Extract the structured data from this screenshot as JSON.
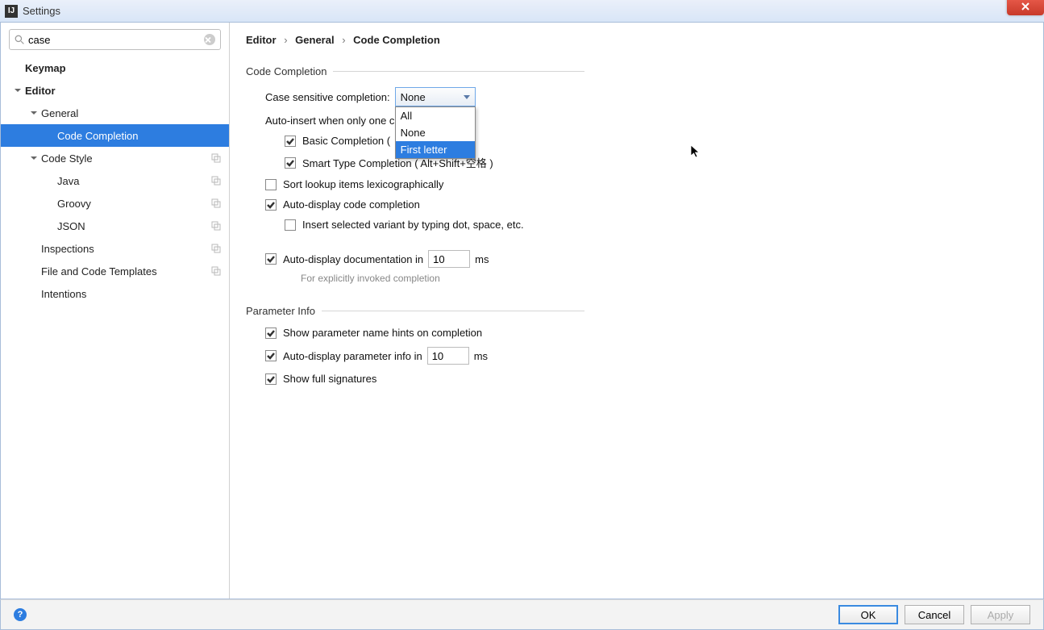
{
  "title": "Settings",
  "search": {
    "value": "case"
  },
  "tree": {
    "keymap": "Keymap",
    "editor": "Editor",
    "general": "General",
    "code_completion": "Code Completion",
    "code_style": "Code Style",
    "java": "Java",
    "groovy": "Groovy",
    "json": "JSON",
    "inspections": "Inspections",
    "file_templates": "File and Code Templates",
    "intentions": "Intentions"
  },
  "breadcrumb": {
    "p1": "Editor",
    "p2": "General",
    "p3": "Code Completion"
  },
  "sections": {
    "code_completion": {
      "legend": "Code Completion",
      "case_sensitive_label": "Case sensitive completion:",
      "combo_selected": "None",
      "combo_options": {
        "o1": "All",
        "o2": "None",
        "o3": "First letter"
      },
      "auto_insert_label": "Auto-insert when only one c",
      "basic_completion": "Basic Completion (",
      "smart_type_completion": "Smart Type Completion ( Alt+Shift+空格 )",
      "sort_lexico": "Sort lookup items lexicographically",
      "auto_display_cc": "Auto-display code completion",
      "insert_variant": "Insert selected variant by typing dot, space, etc.",
      "auto_doc_label_pre": "Auto-display documentation in",
      "auto_doc_value": "10",
      "auto_doc_label_post": "ms",
      "auto_doc_hint": "For explicitly invoked completion"
    },
    "parameter_info": {
      "legend": "Parameter Info",
      "show_param_hints": "Show parameter name hints on completion",
      "auto_param_pre": "Auto-display parameter info in",
      "auto_param_value": "10",
      "auto_param_post": "ms",
      "show_full_sig": "Show full signatures"
    }
  },
  "buttons": {
    "ok": "OK",
    "cancel": "Cancel",
    "apply": "Apply"
  }
}
